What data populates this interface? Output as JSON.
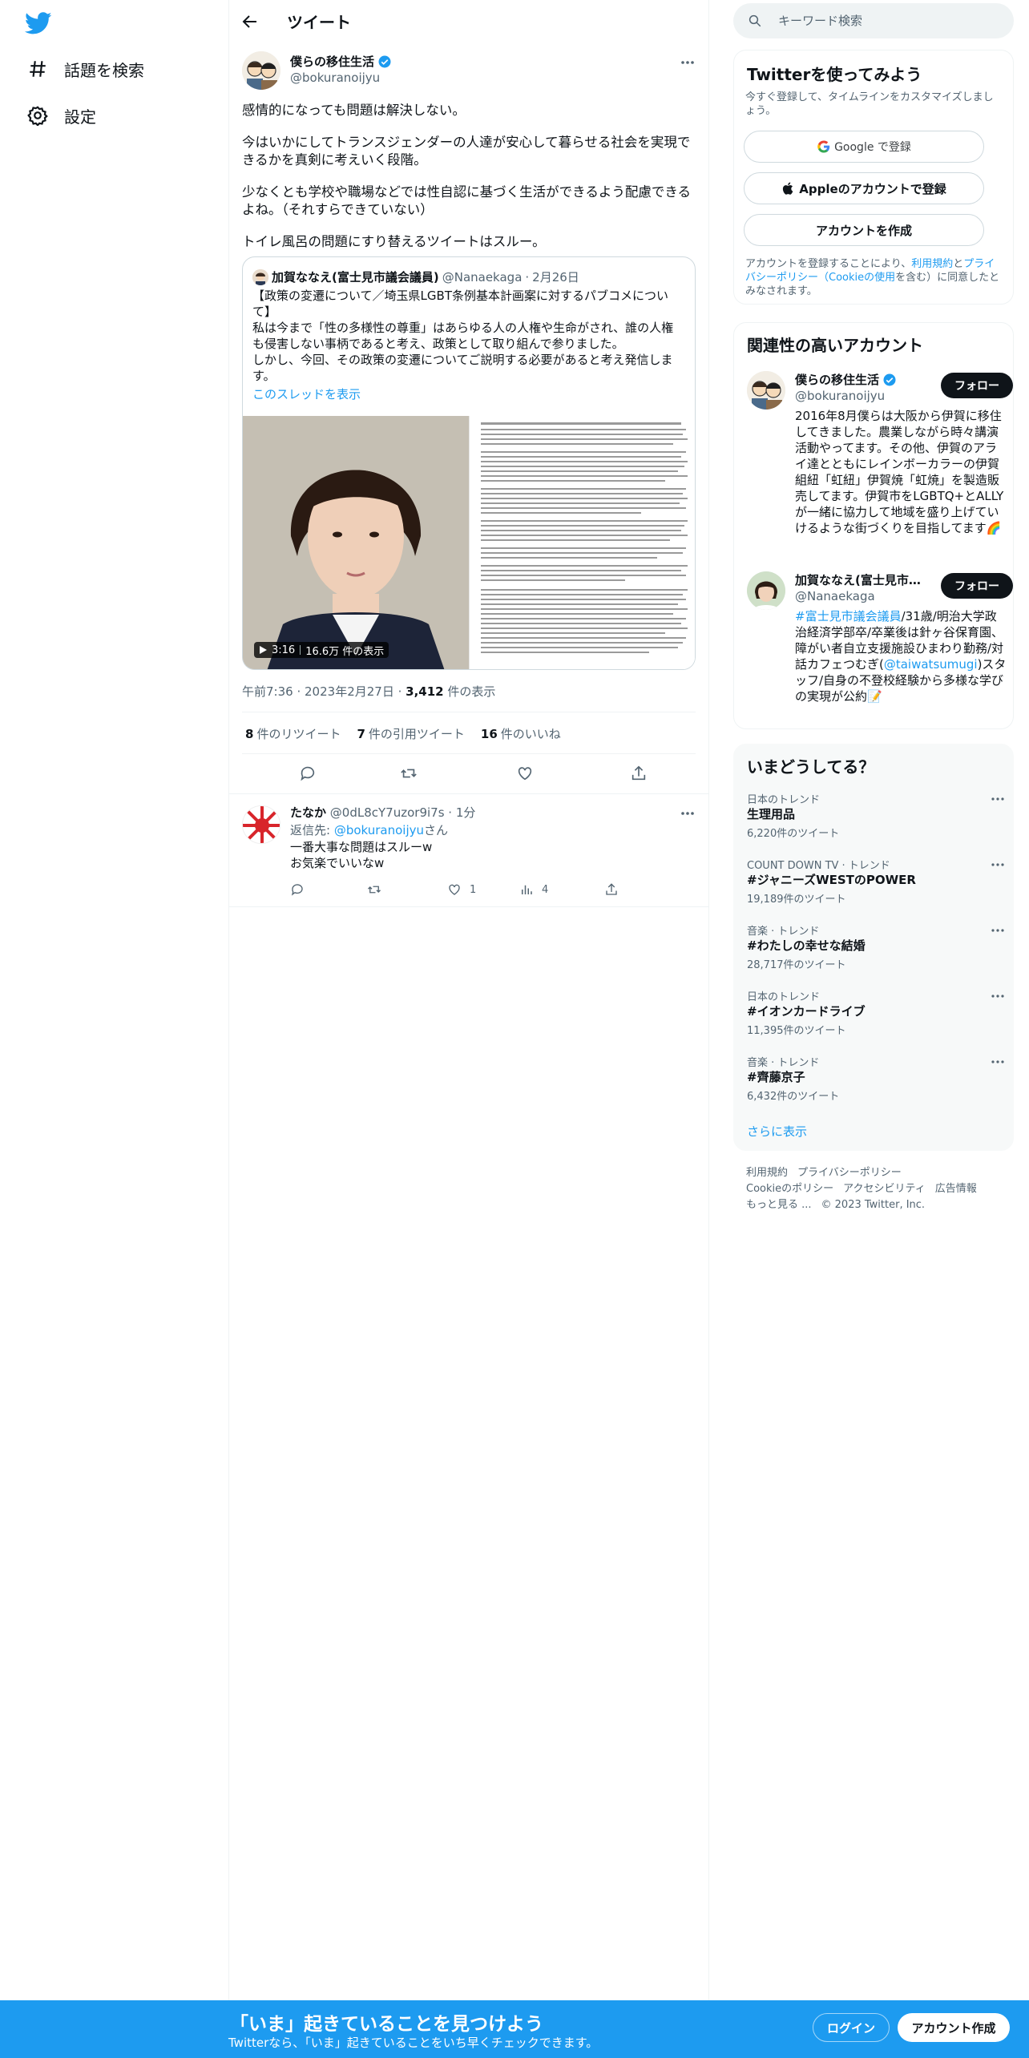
{
  "colors": {
    "brand": "#1d9bf0",
    "text": "#0f1419",
    "muted": "#536471",
    "border": "#eff3f4"
  },
  "nav": {
    "explore_label": "話題を検索",
    "settings_label": "設定"
  },
  "header": {
    "title": "ツイート"
  },
  "tweet": {
    "author_name": "僕らの移住生活",
    "author_handle": "@bokuranoijyu",
    "paragraphs": [
      "感情的になっても問題は解決しない。",
      "今はいかにしてトランスジェンダーの人達が安心して暮らせる社会を実現できるかを真剣に考えいく段階。",
      "少なくとも学校や職場などでは性自認に基づく生活ができるよう配慮できるよね。（それすらできていない）",
      "トイレ風呂の問題にすり替えるツイートはスルー。"
    ],
    "quote": {
      "name": "加賀ななえ(富士見市議会議員)",
      "handle": "@Nanaekaga",
      "date": "2月26日",
      "text": "【政策の変遷について／埼玉県LGBT条例基本計画案に対するパブコメについて】\n私は今まで「性の多様性の尊重」はあらゆる人の人権や生命がされ、誰の人権も侵害しない事柄であると考え、政策として取り組んで参りました。\nしかし、今回、その政策の変遷についてご説明する必要があると考え発信します。",
      "show_thread": "このスレッドを表示",
      "video_duration": "3:16",
      "video_views": "16.6万 件の表示"
    },
    "time": "午前7:36",
    "date": "2023年2月27日",
    "views_count": "3,412",
    "views_label": "件の表示",
    "retweets_count": "8",
    "retweets_label": "件のリツイート",
    "quotes_count": "7",
    "quotes_label": "件の引用ツイート",
    "likes_count": "16",
    "likes_label": "件のいいね"
  },
  "reply": {
    "name": "たなか",
    "handle": "@0dL8cY7uzor9i7s",
    "time": "1分",
    "reply_to_prefix": "返信先: ",
    "reply_to_mention": "@bokuranoijyu",
    "reply_to_suffix": "さん",
    "text": "一番大事な問題はスルーw\nお気楽でいいなw",
    "likes": "1",
    "views": "4"
  },
  "search": {
    "placeholder": "キーワード検索"
  },
  "signup": {
    "title": "Twitterを使ってみよう",
    "subtitle": "今すぐ登録して、タイムラインをカスタマイズしましょう。",
    "google_label": "Google で登録",
    "apple_label": "Appleのアカウントで登録",
    "create_label": "アカウントを作成",
    "legal_prefix": "アカウントを登録することにより、",
    "legal_terms": "利用規約",
    "legal_and": "と",
    "legal_privacy": "プライバシーポリシー（Cookieの使用",
    "legal_suffix": "を含む）に同意したとみなされます。"
  },
  "related": {
    "title": "関連性の高いアカウント",
    "follow_label": "フォロー",
    "accounts": [
      {
        "name": "僕らの移住生活",
        "handle": "@bokuranoijyu",
        "bio": "2016年8月僕らは大阪から伊賀に移住してきました。農業しながら時々講演活動やってます。その他、伊賀のアライ達とともにレインボーカラーの伊賀組紐「虹紐」伊賀焼「虹焼」を製造販売してます。伊賀市をLGBTQ+とALLYが一緒に協力して地域を盛り上げていけるような街づくりを目指してます🌈"
      },
      {
        "name": "加賀ななえ(富士見市議会議員)",
        "handle": "@Nanaekaga",
        "bio_tag": "#富士見市議会議員",
        "bio_mid": "/31歳/明治大学政治経済学部卒/卒業後は針ヶ谷保育園、障がい者自立支援施設ひまわり勤務/対話カフェつむぎ(",
        "bio_mention": "@taiwatsumugi",
        "bio_end": ")スタッフ/自身の不登校経験から多様な学びの実現が公約📝"
      }
    ]
  },
  "trends": {
    "title": "いまどうしてる？",
    "items": [
      {
        "context": "日本のトレンド",
        "name": "生理用品",
        "count": "6,220件のツイート"
      },
      {
        "context": "COUNT DOWN TV · トレンド",
        "name": "#ジャニーズWESTのPOWER",
        "count": "19,189件のツイート"
      },
      {
        "context": "音楽 · トレンド",
        "name": "#わたしの幸せな結婚",
        "count": "28,717件のツイート"
      },
      {
        "context": "日本のトレンド",
        "name": "#イオンカードライブ",
        "count": "11,395件のツイート"
      },
      {
        "context": "音楽 · トレンド",
        "name": "#齊藤京子",
        "count": "6,432件のツイート"
      }
    ],
    "show_more": "さらに表示"
  },
  "footer": {
    "terms": "利用規約",
    "privacy": "プライバシーポリシー",
    "cookie": "Cookieのポリシー",
    "accessibility": "アクセシビリティ",
    "ads": "広告情報",
    "more": "もっと見る ...",
    "copyright": "© 2023 Twitter, Inc."
  },
  "bottombar": {
    "title": "「いま」起きていることを見つけよう",
    "subtitle": "Twitterなら、「いま」起きていることをいち早くチェックできます。",
    "login_label": "ログイン",
    "signup_label": "アカウント作成"
  }
}
